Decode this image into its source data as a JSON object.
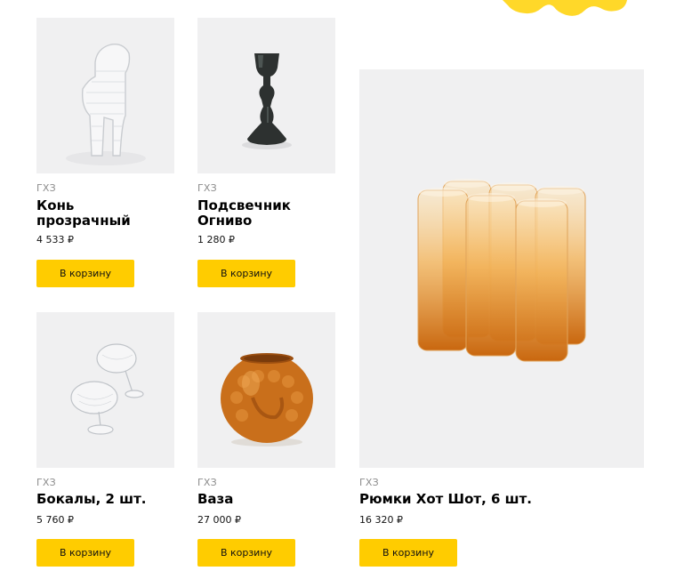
{
  "colors": {
    "accent": "#ffcc00",
    "photo_background": "#f0f0f1",
    "brand_text": "#8c8c8c"
  },
  "products": [
    {
      "brand": "ГХЗ",
      "name": "Конь\nпрозрачный",
      "price": "4 533 ₽",
      "button": "В корзину"
    },
    {
      "brand": "ГХЗ",
      "name": "Подсвечник\nОгниво",
      "price": "1 280 ₽",
      "button": "В корзину"
    },
    {
      "brand": "ГХЗ",
      "name": "Бокалы, 2 шт.",
      "price": "5 760 ₽",
      "button": "В корзину"
    },
    {
      "brand": "ГХЗ",
      "name": "Ваза",
      "price": "27 000 ₽",
      "button": "В корзину"
    },
    {
      "brand": "ГХЗ",
      "name": "Рюмки Хот Шот, 6 шт.",
      "price": "16 320 ₽",
      "button": "В корзину"
    }
  ]
}
